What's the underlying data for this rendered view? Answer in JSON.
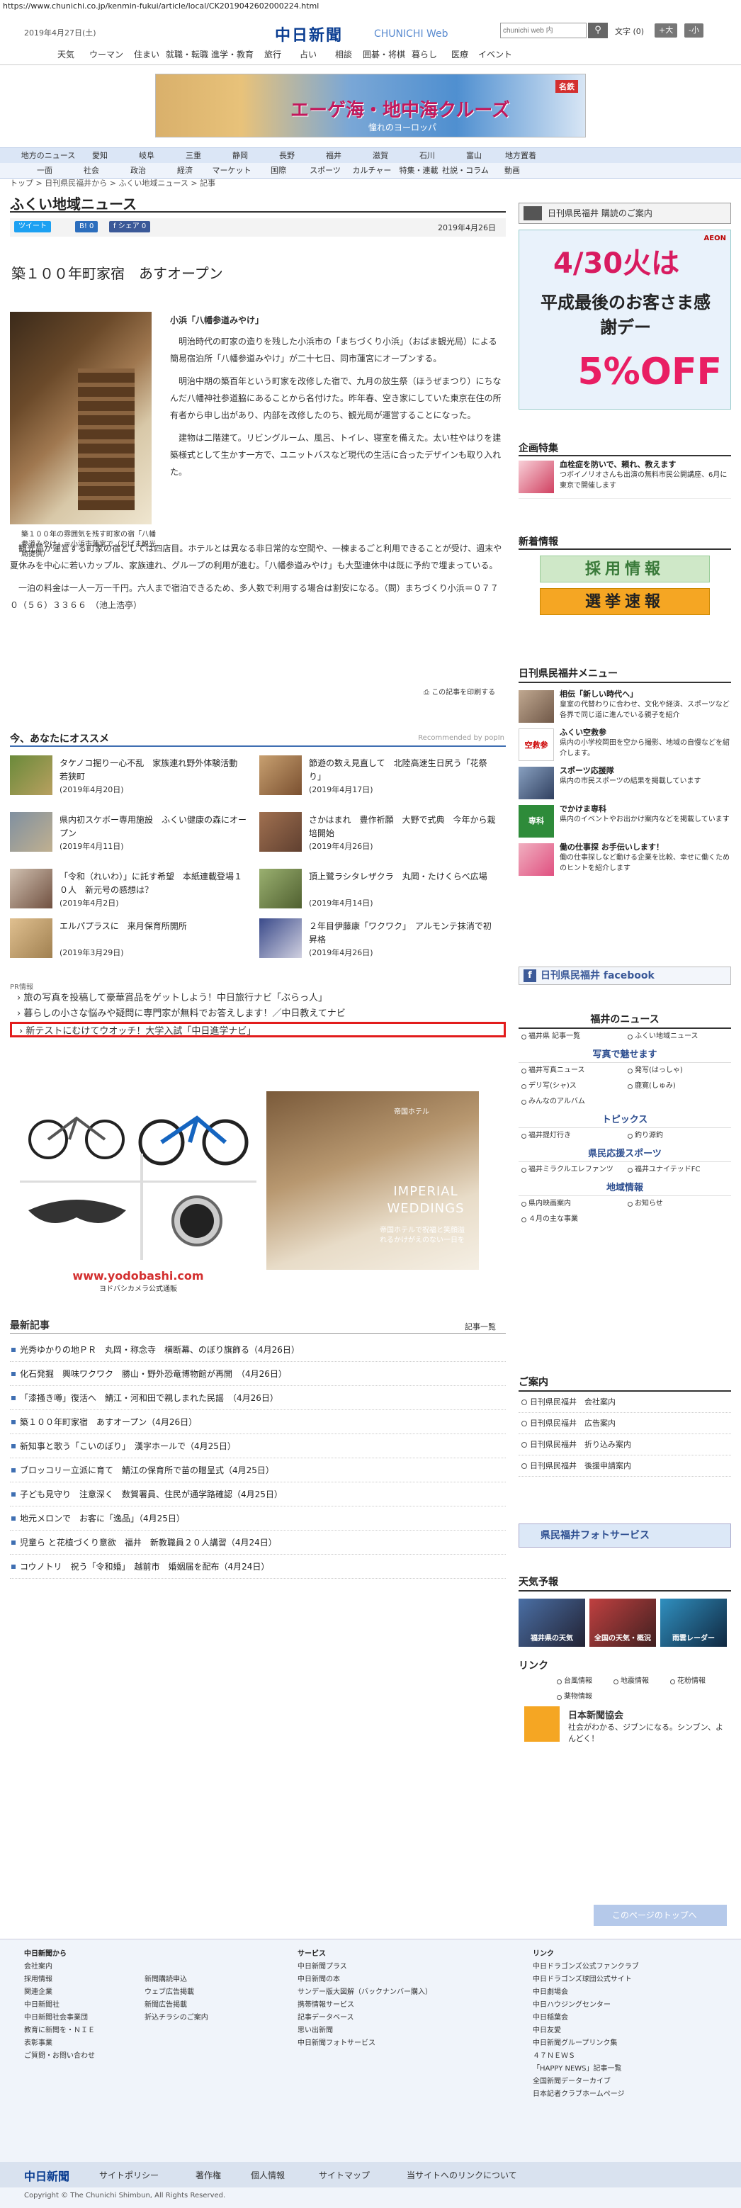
{
  "browser": {
    "url": "https://www.chunichi.co.jp/kenmin-fukui/article/local/CK2019042602000224.html"
  },
  "header": {
    "date": "2019年4月27日(土)",
    "logo": "中日新聞",
    "logo_sub": "CHUNICHI Web",
    "search_placeholder": "chunichi web 内",
    "search_icon": "magnifier",
    "font_size_label": "文字",
    "font_reset": "(0)",
    "font_large": "+大",
    "font_small": "-小"
  },
  "top_nav": [
    "天気",
    "ウーマン",
    "住まい",
    "就職・転職",
    "進学・教育",
    "旅行",
    "占い",
    "相談",
    "囲碁・将棋",
    "暮らし",
    "医療",
    "イベント"
  ],
  "banner": {
    "title": "エーゲ海・地中海クルーズ",
    "subtitle": "憧れのヨーロッパ",
    "badge": "名鉄"
  },
  "region_nav": [
    "地方のニュース",
    "愛知",
    "岐阜",
    "三重",
    "静岡",
    "長野",
    "福井",
    "滋賀",
    "石川",
    "富山",
    "地方置着"
  ],
  "category_nav": [
    "一面",
    "社会",
    "政治",
    "経済",
    "マーケット",
    "国際",
    "スポーツ",
    "カルチャー",
    "特集・連載",
    "社説・コラム",
    "動画"
  ],
  "breadcrumb": "トップ > 日刊県民福井から > ふくい地域ニュース > 記事",
  "section_title": "ふくい地域ニュース",
  "share": {
    "tweet": "ツイート",
    "hatena": "B! 0",
    "fb_share": "f シェア 0"
  },
  "article": {
    "date": "2019年4月26日",
    "title": "築１００年町家宿　あすオープン",
    "subhead": "小浜「八幡参道みやけ」",
    "caption": "築１００年の雰囲気を残す町家の宿「八幡参道みやけ」＝小浜市蓮宮で（おばま観光局提供）",
    "paragraphs": [
      "明治時代の町家の造りを残した小浜市の「まちづくり小浜」（おばま観光局）による簡易宿泊所「八幡参道みやけ」が二十七日、同市蓮宮にオープンする。",
      "明治中期の築百年という町家を改修した宿で、九月の放生祭（ほうぜまつり）にちなんだ八幡神社参道脇にあることから名付けた。昨年春、空き家にしていた東京在住の所有者から申し出があり、内部を改修したのち、観光局が運営することになった。",
      "建物は二階建て。リビングルーム、風呂、トイレ、寝室を備えた。太い柱やはりを建築様式として生かす一方で、ユニットバスなど現代の生活に合ったデザインも取り入れた。",
      "観光局が運営する町家の宿としては四店目。ホテルとは異なる非日常的な空間や、一棟まるごと利用できることが受け、週末や夏休みを中心に若いカップル、家族連れ、グループの利用が進む。「八幡参道みやけ」も大型連休中は既に予約で埋まっている。",
      "一泊の料金は一人一万一千円。六人まで宿泊できるため、多人数で利用する場合は割安になる。（問）まちづくり小浜＝０７７０（５６）３３６６　（池上浩亭）"
    ],
    "print_label": "この記事を印刷する"
  },
  "recommend": {
    "title": "今、あなたにオススメ",
    "by": "Recommended by popIn",
    "items": [
      {
        "title": "タケノコ掘り一心不乱　家族連れ野外体験活動　若狭町",
        "date": "(2019年4月20日)"
      },
      {
        "title": "節遊の数え見直して　北陸高速生日尻う「花祭り」",
        "date": "(2019年4月17日)"
      },
      {
        "title": "県内初スケボー専用施設　ふくい健康の森にオープン",
        "date": "(2019年4月11日)"
      },
      {
        "title": "さかはまれ　豊作祈願　大野で式典　今年から栽培開始",
        "date": "(2019年4月26日)"
      },
      {
        "title": "「令和（れいわ）」に託す希望　本紙連載登場１０人　新元号の感想は？",
        "date": "(2019年4月2日)"
      },
      {
        "title": "頂上鷺ラシタレザクラ　丸岡・たけくらべ広場",
        "date": "(2019年4月14日)"
      },
      {
        "title": "エルパプラスに　来月保育所開所",
        "date": "(2019年3月29日)"
      },
      {
        "title": "２年目伊藤康「ワクワク」　アルモンテ抹消で初昇格",
        "date": "(2019年4月26日)"
      }
    ]
  },
  "pr": {
    "label": "PR情報",
    "items": [
      "旅の写真を投稿して豪華賞品をゲットしよう！中日旅行ナビ「ぶらっ人」",
      "暮らしの小さな悩みや疑問に専門家が無料でお答えします！／中日教えてナビ",
      "新テストにむけてウオッチ！大学入試「中日進学ナビ」"
    ]
  },
  "ads": {
    "yodobashi_url": "www.yodobashi.com",
    "yodobashi_label": "ヨドバシカメラ公式通販",
    "wedding_title": "IMPERIAL WEDDINGS",
    "wedding_hotel": "帝国ホテル",
    "wedding_copy": "帝国ホテルで祝福と笑顔溢れるかけがえのない一日を"
  },
  "latest": {
    "title": "最新記事",
    "all_label": "記事一覧",
    "items": [
      "光秀ゆかりの地ＰＲ　丸岡・称念寺　横断幕、のぼり旗飾る（4月26日）",
      "化石発掘　興味ワクワク　勝山・野外恐竜博物館が再開　（4月26日）",
      "「漆掻き噂」復活へ　鯖江・河和田で親しまれた民謡　（4月26日）",
      "築１００年町家宿　あすオープン（4月26日）",
      "新知事と歌う「こいのぼり」　漢字ホールで（4月25日）",
      "ブロッコリー立派に育て　鯖江の保育所で苗の贈呈式（4月25日）",
      "子ども見守り　注意深く　数賀署員、住民が通学路確認（4月25日）",
      "地元メロンで　お客に「逸品」（4月25日）",
      "児童ら と花植づくり意欲　福井　新教職員２０人講習（4月24日）",
      "コウノトリ　祝う「令和婚」　越前市　婚姻届を配布（4月24日）"
    ]
  },
  "sidebar": {
    "subscribe": "日刊県民福井 購読のご案内",
    "aeon": {
      "date": "4/30火は",
      "headline": "平成最後のお客さま感謝デー",
      "percent": "5%OFF",
      "brand": "AEON"
    },
    "features_title": "企画特集",
    "features": [
      {
        "title": "血栓症を防いで、頼れ、教えます",
        "desc": "つボイノリオさんも出演の無料市民公開講座、6月に東京で開催します"
      }
    ],
    "news_info_title": "新着情報",
    "recruit_label": "採用情報",
    "election_label": "選挙速報",
    "menu_title": "日刊県民福井メニュー",
    "menu": [
      {
        "title": "相伝「新しい時代へ」",
        "desc": "皇室の代替わりに合わせ、文化や経済、スポーツなど各界で同じ道に進んでいる親子を紹介"
      },
      {
        "title": "ふくい空救参",
        "desc": "県内の小学校岡田を空から撮影、地域の自慢などを紹介します。"
      },
      {
        "title": "スポーツ応援隊",
        "desc": "県内の市民スポーツの結果を掲載しています"
      },
      {
        "title": "でかけま専科",
        "desc": "県内のイベントやお出かけ案内などを掲載しています"
      },
      {
        "title": "働の仕事探 お手伝いします！",
        "desc": "働の仕事探しなど動ける企業を比較、幸せに働くためのヒントを紹介します"
      }
    ],
    "facebook": "日刊県民福井 facebook",
    "fukui_news_title": "福井のニュース",
    "fukui_news_links": [
      "福井県 記事一覧",
      "ふくい地域ニュース"
    ],
    "photo_title": "写真で魅せます",
    "photo_links": [
      "福井写真ニュース",
      "発写(はっしゃ)",
      "デリ写(シャ)ス",
      "鹿寛(しゅみ)",
      "みんなのアルバム"
    ],
    "topics_title": "トピックス",
    "topics_links": [
      "福井提灯行き",
      "釣り源釣"
    ],
    "sports_title": "県民応援スポーツ",
    "sports_links": [
      "福井ミラクルエレファンツ",
      "福井ユナイテッドFC"
    ],
    "region_title": "地域情報",
    "region_links": [
      "県内映画案内",
      "お知らせ",
      "４月の主な事業"
    ],
    "annai_title": "ご案内",
    "annai": [
      "日刊県民福井　会社案内",
      "日刊県民福井　広告案内",
      "日刊県民福井　折り込み案内",
      "日刊県民福井　後援申請案内"
    ],
    "photo_service": "県民福井フォトサービス",
    "weather_title": "天気予報",
    "weather": [
      "福井県の天気",
      "全国の天気・概況",
      "雨雲レーダー"
    ],
    "links_title": "リンク",
    "links": [
      "台風情報",
      "地震情報",
      "花粉情報",
      "薬物情報"
    ],
    "nihon_title": "日本新聞協会",
    "nihon_desc": "社会がわかる、ジブンになる。シンブン、よんどく！",
    "to_top": "このページのトップへ"
  },
  "footer": {
    "col1_title": "中日新聞から",
    "col1": [
      "会社案内",
      "採用情報",
      "関連企業",
      "中日新聞社",
      "中日新聞社会事業団",
      "教育に新聞を・ＮＩＥ",
      "表彰事業",
      "ご質問・お問い合わせ"
    ],
    "col2": [
      "新聞購読申込",
      "ウェブ広告掲載",
      "新聞広告掲載",
      "折込チラシのご案内"
    ],
    "col3_title": "サービス",
    "col3": [
      "中日新聞プラス",
      "中日新聞の本",
      "サンデー版大図解（バックナンバー購入）",
      "携帯情報サービス",
      "記事データベース",
      "思い出新聞",
      "中日新聞フォトサービス"
    ],
    "col4_title": "リンク",
    "col4": [
      "中日ドラゴンズ公式ファンクラブ",
      "中日ドラゴンズ球団公式サイト",
      "中日劇場会",
      "中日ハウジングセンター",
      "中日稲葉会",
      "中日友愛",
      "中日新聞グループリンク集",
      "４７ＮＥＷＳ",
      "「HAPPY NEWS」記事一覧",
      "全国新聞データーカイブ",
      "日本記者クラブホームページ"
    ],
    "bottom": [
      "中日新聞",
      "サイトポリシー",
      "著作権",
      "個人情報",
      "サイトマップ",
      "当サイトへのリンクについて"
    ],
    "copyright": "Copyright © The Chunichi Shimbun, All Rights Reserved."
  }
}
